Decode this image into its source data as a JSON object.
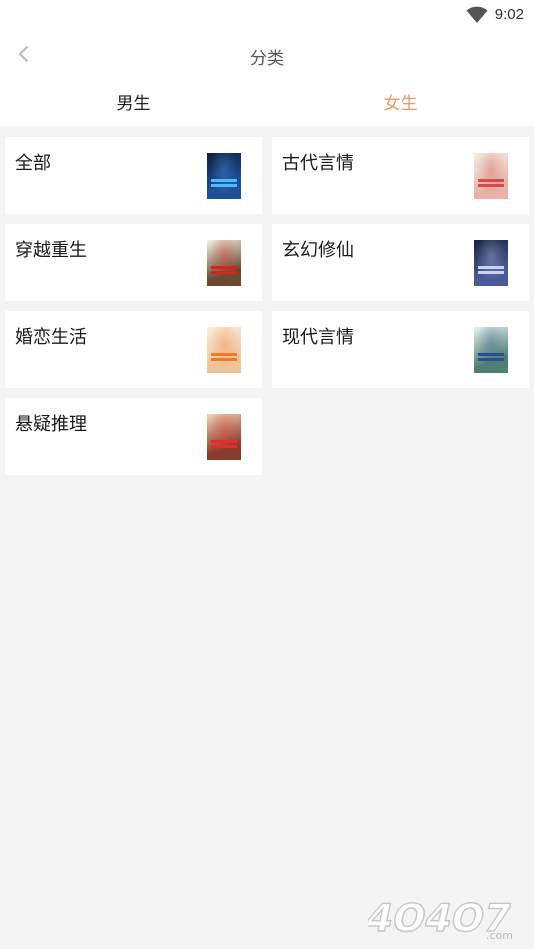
{
  "status": {
    "time": "9:02",
    "wifi_icon": "wifi-icon"
  },
  "header": {
    "title": "分类",
    "back_icon": "chevron-left-icon"
  },
  "tabs": [
    {
      "label": "男生",
      "active": false
    },
    {
      "label": "女生",
      "active": true
    }
  ],
  "categories": [
    {
      "label": "全部",
      "cover_colors": [
        "#0d1b3a",
        "#1f4f9a",
        "#4fb8ff"
      ]
    },
    {
      "label": "古代言情",
      "cover_colors": [
        "#f4efe6",
        "#e8b4a8",
        "#d64b4b"
      ]
    },
    {
      "label": "穿越重生",
      "cover_colors": [
        "#f7f1e6",
        "#6b4a34",
        "#d6241d"
      ]
    },
    {
      "label": "玄幻修仙",
      "cover_colors": [
        "#1a2242",
        "#4a5a9a",
        "#c9d3f0"
      ]
    },
    {
      "label": "婚恋生活",
      "cover_colors": [
        "#fbeede",
        "#f0c49a",
        "#e97b2a"
      ]
    },
    {
      "label": "现代言情",
      "cover_colors": [
        "#e6f1ec",
        "#4f7f73",
        "#2b4f8a"
      ]
    },
    {
      "label": "悬疑推理",
      "cover_colors": [
        "#f2d6b8",
        "#8a3c2a",
        "#e62b2b"
      ]
    }
  ],
  "colors": {
    "accent": "#e79a62",
    "background": "#f4f4f4",
    "card": "#ffffff"
  },
  "watermark": {
    "text": "4O4O7",
    "suffix": ".com"
  }
}
